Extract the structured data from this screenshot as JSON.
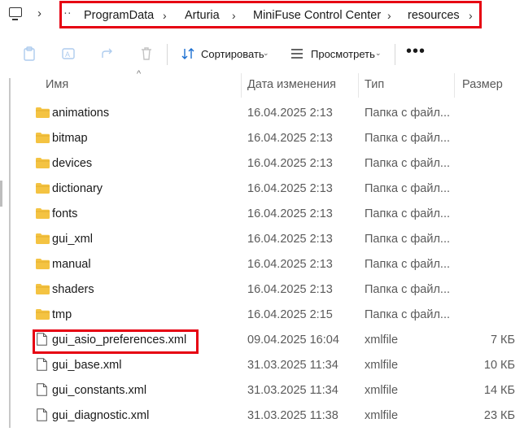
{
  "breadcrumb": {
    "ellipsis": "··",
    "items": [
      "ProgramData",
      "Arturia",
      "MiniFuse Control Center",
      "resources"
    ]
  },
  "toolbar": {
    "sort_label": "Сортировать",
    "view_label": "Просмотреть",
    "more_label": "•••"
  },
  "columns": {
    "name": "Имя",
    "date": "Дата изменения",
    "type": "Тип",
    "size": "Размер"
  },
  "files": [
    {
      "kind": "folder",
      "name": "animations",
      "date": "16.04.2025 2:13",
      "type": "Папка с файл...",
      "size": ""
    },
    {
      "kind": "folder",
      "name": "bitmap",
      "date": "16.04.2025 2:13",
      "type": "Папка с файл...",
      "size": ""
    },
    {
      "kind": "folder",
      "name": "devices",
      "date": "16.04.2025 2:13",
      "type": "Папка с файл...",
      "size": ""
    },
    {
      "kind": "folder",
      "name": "dictionary",
      "date": "16.04.2025 2:13",
      "type": "Папка с файл...",
      "size": ""
    },
    {
      "kind": "folder",
      "name": "fonts",
      "date": "16.04.2025 2:13",
      "type": "Папка с файл...",
      "size": ""
    },
    {
      "kind": "folder",
      "name": "gui_xml",
      "date": "16.04.2025 2:13",
      "type": "Папка с файл...",
      "size": ""
    },
    {
      "kind": "folder",
      "name": "manual",
      "date": "16.04.2025 2:13",
      "type": "Папка с файл...",
      "size": ""
    },
    {
      "kind": "folder",
      "name": "shaders",
      "date": "16.04.2025 2:13",
      "type": "Папка с файл...",
      "size": ""
    },
    {
      "kind": "folder",
      "name": "tmp",
      "date": "16.04.2025 2:15",
      "type": "Папка с файл...",
      "size": ""
    },
    {
      "kind": "file",
      "name": "gui_asio_preferences.xml",
      "date": "09.04.2025 16:04",
      "type": "xmlfile",
      "size": "7 КБ"
    },
    {
      "kind": "file",
      "name": "gui_base.xml",
      "date": "31.03.2025 11:34",
      "type": "xmlfile",
      "size": "10 КБ"
    },
    {
      "kind": "file",
      "name": "gui_constants.xml",
      "date": "31.03.2025 11:34",
      "type": "xmlfile",
      "size": "14 КБ"
    },
    {
      "kind": "file",
      "name": "gui_diagnostic.xml",
      "date": "31.03.2025 11:38",
      "type": "xmlfile",
      "size": "23 КБ"
    }
  ],
  "colors": {
    "highlight": "#e60012",
    "folder": "#f4c342"
  }
}
